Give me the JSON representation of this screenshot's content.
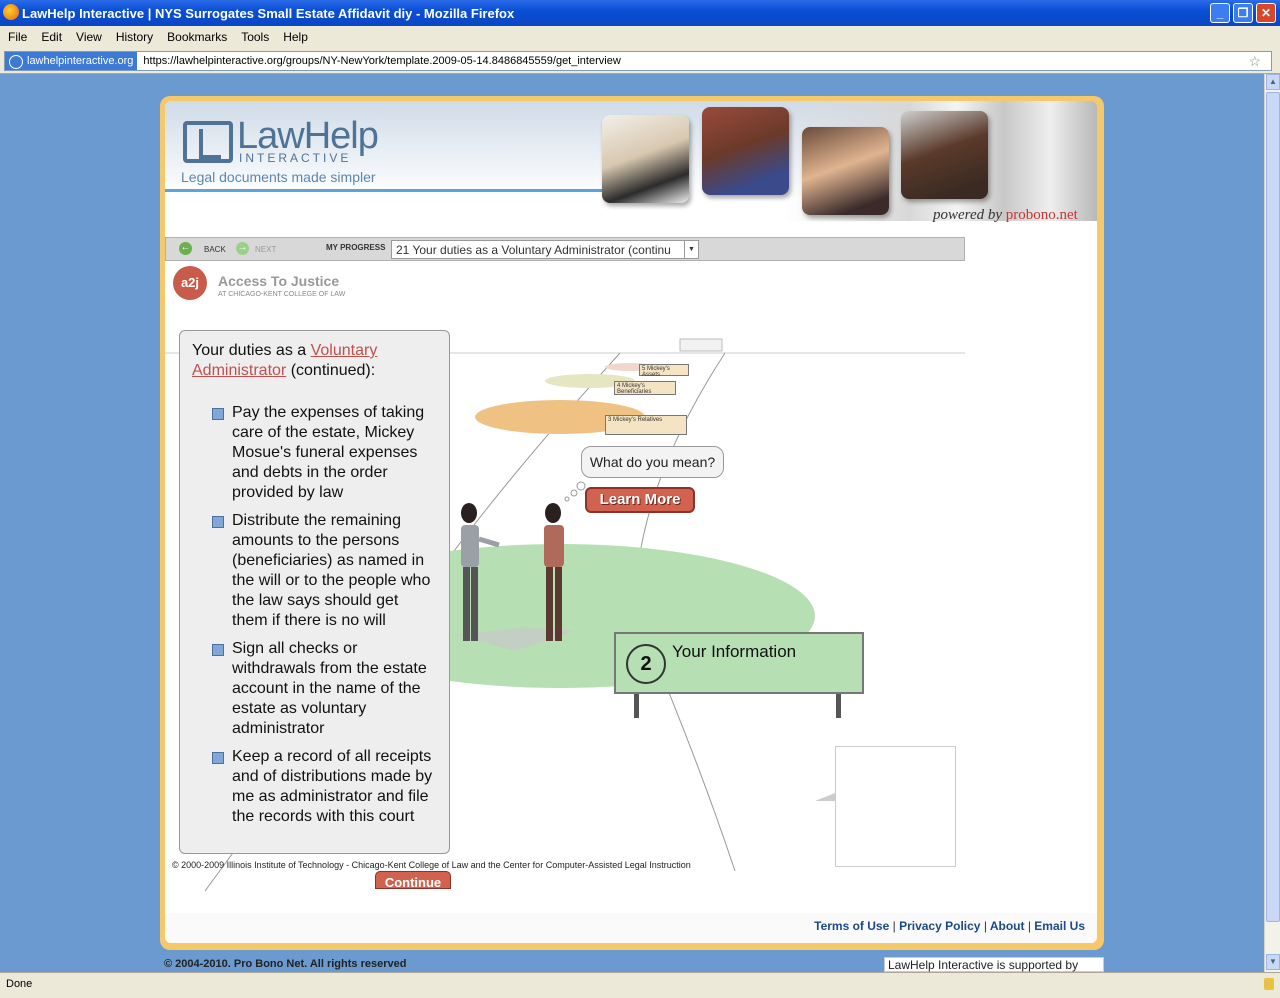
{
  "window": {
    "title": "LawHelp Interactive | NYS Surrogates Small Estate Affidavit diy - Mozilla Firefox",
    "minimize": "_",
    "restore": "❐",
    "close": "✕"
  },
  "menu": [
    "File",
    "Edit",
    "View",
    "History",
    "Bookmarks",
    "Tools",
    "Help"
  ],
  "address": {
    "site_identity": "lawhelpinteractive.org",
    "url": "https://lawhelpinteractive.org/groups/NY-NewYork/template.2009-05-14.8486845559/get_interview"
  },
  "status": "Done",
  "header": {
    "logo": "LawHelp",
    "logo_sub": "INTERACTIVE",
    "tagline": "Legal documents made simpler",
    "powered_by": "powered by",
    "powered_brand": "probono.net"
  },
  "nav": {
    "back": "BACK",
    "next": "NEXT",
    "progress_label": "MY PROGRESS",
    "progress_value": "21 Your duties as a Voluntary Administrator (continu"
  },
  "a2j": {
    "badge": "a2j",
    "title": "Access To Justice",
    "subtitle": "AT CHICAGO-KENT COLLEGE OF LAW"
  },
  "question": {
    "intro": "Your duties as a",
    "link": "Voluntary Administrator",
    "suffix": "(continued):",
    "duties": [
      "Pay the expenses of taking care of the estate, Mickey Mosue's funeral expenses and debts in the order provided by law",
      "Distribute the remaining amounts to the persons (beneficiaries) as named in the will or to the people who the law says should get them if there is no will",
      "Sign all checks or withdrawals from the estate account in the name of the estate as voluntary administrator",
      "Keep a record of all receipts and of distributions made by me as administrator and file the records with this court"
    ]
  },
  "scene": {
    "speech": "What do you mean?",
    "learn_more": "Learn More",
    "step_number": "2",
    "step_label": "Your Information",
    "small_signs": [
      {
        "num": "5",
        "label": "Mickey's Assets"
      },
      {
        "num": "4",
        "label": "Mickey's Beneficiaries"
      },
      {
        "num": "3",
        "label": "Mickey's Relatives"
      }
    ]
  },
  "copyright": "© 2000-2009 Illinois Institute of Technology - Chicago-Kent College of Law and the Center for Computer-Assisted Legal Instruction",
  "continue": "Continue",
  "footer": {
    "links": [
      "Terms of Use",
      "Privacy Policy",
      "About",
      "Email Us"
    ],
    "copyright": "© 2004-2010. Pro Bono Net. All rights reserved",
    "supported": "LawHelp Interactive is supported by"
  }
}
